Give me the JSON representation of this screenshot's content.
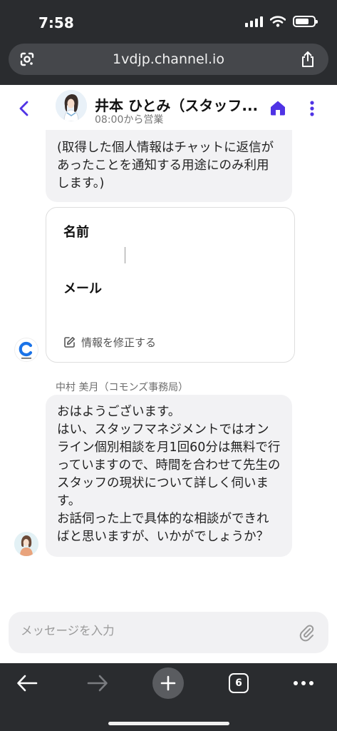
{
  "status_bar": {
    "time": "7:58"
  },
  "browser": {
    "url": "1vdjp.channel.io",
    "tab_count": "6"
  },
  "chat_header": {
    "name": "井本 ひとみ（スタッフ...",
    "hours": "08:00から営業"
  },
  "messages": {
    "notice_text": "(取得した個人情報はチャットに返信があったことを通知する用途にのみ利用します。)",
    "form": {
      "name_label": "名前",
      "email_label": "メール",
      "edit_label": "情報を修正する"
    },
    "reply": {
      "sender": "中村 美月（コモンズ事務局）",
      "lines": [
        "おはようございます。",
        "はい、スタッフマネジメントではオンライン個別相談を月1回60分は無料で行っていますので、時間を合わせて先生のスタッフの現状について詳しく伺います。",
        "お話伺った上で具体的な相談ができればと思いますが、いかがでしょうか？"
      ]
    }
  },
  "composer": {
    "placeholder": "メッセージを入力"
  },
  "colors": {
    "accent": "#4f33e5",
    "chrome_bg": "#2a2c2f",
    "bubble_bg": "#f2f2f4"
  }
}
